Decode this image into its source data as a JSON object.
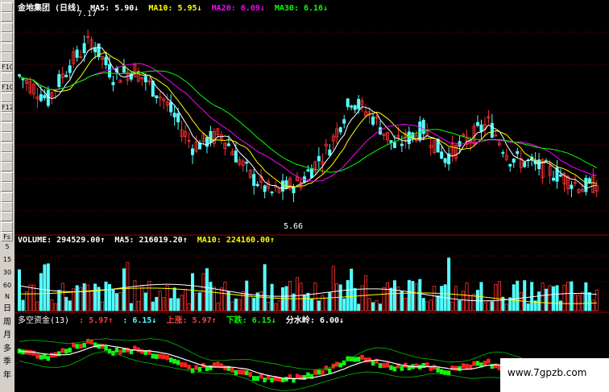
{
  "main_header": {
    "stock": "金地集团 (日线)",
    "ma5": "MA5: 5.90↓",
    "ma10": "MA10: 5.95↓",
    "ma20": "MA20: 6.09↓",
    "ma30": "MA30: 6.16↓"
  },
  "price_labels": {
    "high": "7.17",
    "low": "5.66"
  },
  "volume_header": {
    "volume": "VOLUME: 294529.00↑",
    "ma5": "MA5: 216019.20↑",
    "ma10": "MA10: 224160.00↑"
  },
  "indicator_header": {
    "name": "多空资金(13)",
    "v1": ": 5.97↑",
    "v2": ": 6.15↓",
    "up": "上涨: 5.97↑",
    "down": "下跌: 6.15↓",
    "watershed": "分水岭: 6.00↓"
  },
  "toolbar": {
    "volume_ticks": [
      "5",
      "15",
      "30",
      "60",
      "N"
    ],
    "periods": [
      "日",
      "周",
      "月",
      "多",
      "季",
      "年"
    ],
    "button_labels": [
      "",
      "",
      "",
      "",
      "",
      "",
      "F10",
      "",
      "F10",
      "",
      "F12",
      "",
      "",
      "",
      "",
      "",
      "",
      "",
      "",
      "",
      "",
      "",
      "",
      "Fs"
    ]
  },
  "colors": {
    "up": "#ff3232",
    "down": "#54ffff",
    "ma5": "#ffffff",
    "ma10": "#ffff00",
    "ma20": "#ff00ff",
    "ma30": "#00ff00",
    "frame": "#a00000"
  },
  "watermark": "www.7gpzb.com"
}
